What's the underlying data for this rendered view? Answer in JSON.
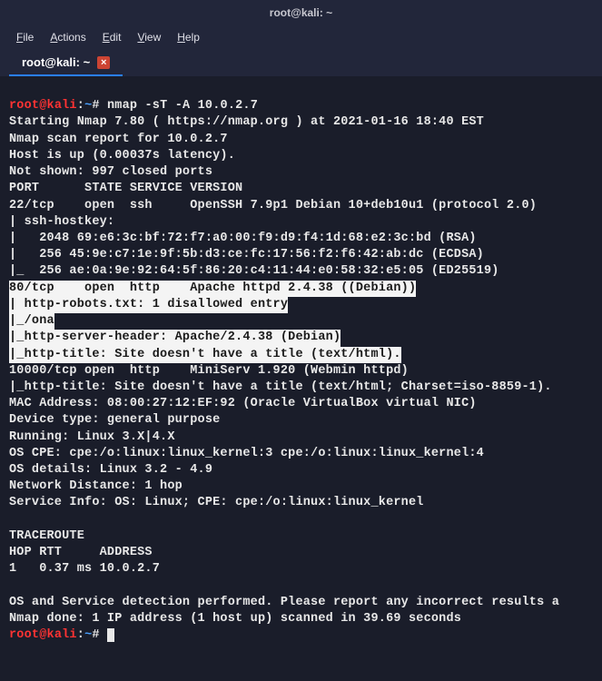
{
  "titlebar": {
    "title": "root@kali: ~"
  },
  "menubar": {
    "items": [
      "File",
      "Actions",
      "Edit",
      "View",
      "Help"
    ]
  },
  "tabbar": {
    "tabs": [
      {
        "label": "root@kali: ~",
        "active": true
      }
    ]
  },
  "prompt1": {
    "user": "root",
    "at": "@",
    "host": "kali",
    "colon": ":",
    "path": "~",
    "hash": "#",
    "command": "nmap -sT -A 10.0.2.7"
  },
  "lines": {
    "l1": "Starting Nmap 7.80 ( https://nmap.org ) at 2021-01-16 18:40 EST",
    "l2": "Nmap scan report for 10.0.2.7",
    "l3": "Host is up (0.00037s latency).",
    "l4": "Not shown: 997 closed ports",
    "l5": "PORT      STATE SERVICE VERSION",
    "l6": "22/tcp    open  ssh     OpenSSH 7.9p1 Debian 10+deb10u1 (protocol 2.0)",
    "l7": "| ssh-hostkey:",
    "l8": "|   2048 69:e6:3c:bf:72:f7:a0:00:f9:d9:f4:1d:68:e2:3c:bd (RSA)",
    "l9": "|   256 45:9e:c7:1e:9f:5b:d3:ce:fc:17:56:f2:f6:42:ab:dc (ECDSA)",
    "l10": "|_  256 ae:0a:9e:92:64:5f:86:20:c4:11:44:e0:58:32:e5:05 (ED25519)",
    "h1": "80/tcp    open  http    Apache httpd 2.4.38 ((Debian))",
    "h2": "| http-robots.txt: 1 disallowed entry",
    "h3": "|_/ona",
    "h4": "|_http-server-header: Apache/2.4.38 (Debian)",
    "h5": "|_http-title: Site doesn't have a title (text/html).",
    "l11": "10000/tcp open  http    MiniServ 1.920 (Webmin httpd)",
    "l12": "|_http-title: Site doesn't have a title (text/html; Charset=iso-8859-1).",
    "l13": "MAC Address: 08:00:27:12:EF:92 (Oracle VirtualBox virtual NIC)",
    "l14": "Device type: general purpose",
    "l15": "Running: Linux 3.X|4.X",
    "l16": "OS CPE: cpe:/o:linux:linux_kernel:3 cpe:/o:linux:linux_kernel:4",
    "l17": "OS details: Linux 3.2 - 4.9",
    "l18": "Network Distance: 1 hop",
    "l19": "Service Info: OS: Linux; CPE: cpe:/o:linux:linux_kernel",
    "l20": "",
    "l21": "TRACEROUTE",
    "l22": "HOP RTT     ADDRESS",
    "l23": "1   0.37 ms 10.0.2.7",
    "l24": "",
    "l25": "OS and Service detection performed. Please report any incorrect results a",
    "l26": "Nmap done: 1 IP address (1 host up) scanned in 39.69 seconds"
  },
  "prompt2": {
    "user": "root",
    "at": "@",
    "host": "kali",
    "colon": ":",
    "path": "~",
    "hash": "#",
    "command": ""
  }
}
